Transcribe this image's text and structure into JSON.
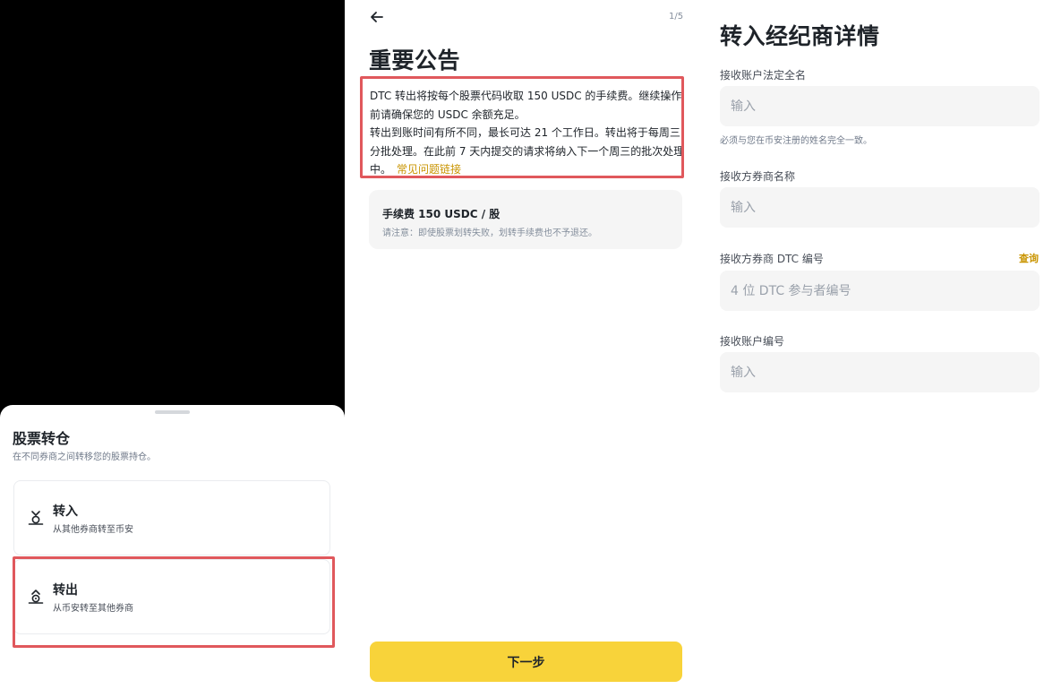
{
  "sheet": {
    "title": "股票转仓",
    "subtitle": "在不同券商之间转移您的股票持仓。",
    "options": [
      {
        "title": "转入",
        "desc": "从其他券商转至币安",
        "icon": "transfer-in-icon"
      },
      {
        "title": "转出",
        "desc": "从币安转至其他券商",
        "icon": "transfer-out-icon"
      }
    ]
  },
  "notice": {
    "page_indicator": "1/5",
    "title": "重要公告",
    "paragraph1": "DTC 转出将按每个股票代码收取 150 USDC 的手续费。继续操作前请确保您的 USDC 余额充足。",
    "paragraph2": "转出到账时间有所不同，最长可达 21 个工作日。转出将于每周三分批处理。在此前 7 天内提交的请求将纳入下一个周三的批次处理中。",
    "faq_link": "常见问题链接",
    "fee_title": "手续费 150 USDC / 股",
    "fee_note": "请注意：即使股票划转失败，划转手续费也不予退还。",
    "next_button": "下一步"
  },
  "form": {
    "title": "转入经纪商详情",
    "fields": [
      {
        "label": "接收账户法定全名",
        "placeholder": "输入",
        "hint": "必须与您在币安注册的姓名完全一致。"
      },
      {
        "label": "接收方券商名称",
        "placeholder": "输入"
      },
      {
        "label": "接收方券商 DTC 编号",
        "placeholder": "4 位 DTC 参与者编号",
        "action": "查询"
      },
      {
        "label": "接收账户编号",
        "placeholder": "输入"
      }
    ]
  },
  "colors": {
    "accent_yellow": "#f8d33a",
    "link_gold": "#c99400",
    "highlight_red": "#e0585c",
    "input_bg": "#f5f5f5"
  }
}
